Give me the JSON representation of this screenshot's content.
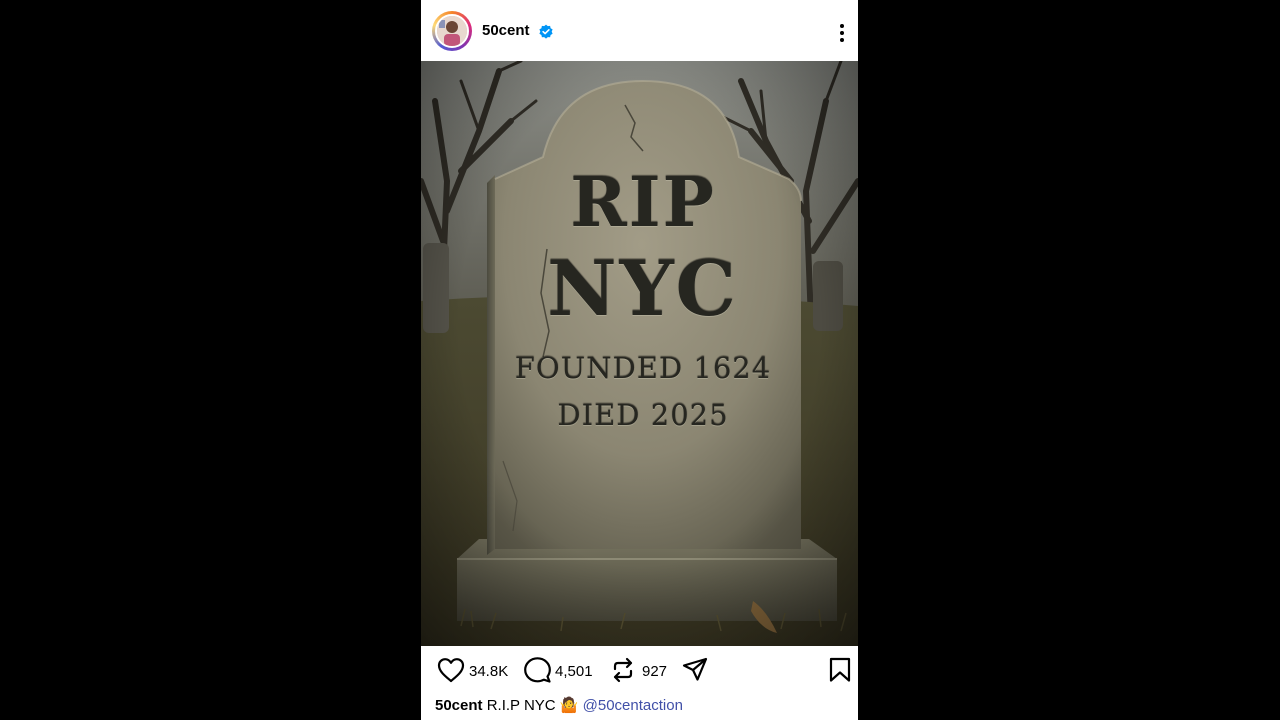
{
  "post": {
    "username": "50cent",
    "verified": true,
    "avatar": "profile-photo",
    "image": {
      "description_icon": "tombstone-photo",
      "epitaph": {
        "line1": "RIP",
        "line2": "NYC",
        "line3": "FOUNDED 1624",
        "line4": "DIED 2025"
      }
    },
    "stats": {
      "likes": "34.8K",
      "comments": "4,501",
      "reposts": "927"
    },
    "caption": {
      "user": "50cent",
      "text": "R.I.P NYC",
      "emoji": "🤷",
      "mention": "@50centaction"
    }
  },
  "icons": {
    "like": "heart-icon",
    "comment": "comment-icon",
    "repost": "repost-icon",
    "share": "share-icon",
    "save": "bookmark-icon",
    "more": "more-icon",
    "verified": "verified-badge-icon"
  },
  "colors": {
    "background": "#000000",
    "card": "#ffffff",
    "verified": "#0095f6",
    "mention": "#4150a8"
  }
}
